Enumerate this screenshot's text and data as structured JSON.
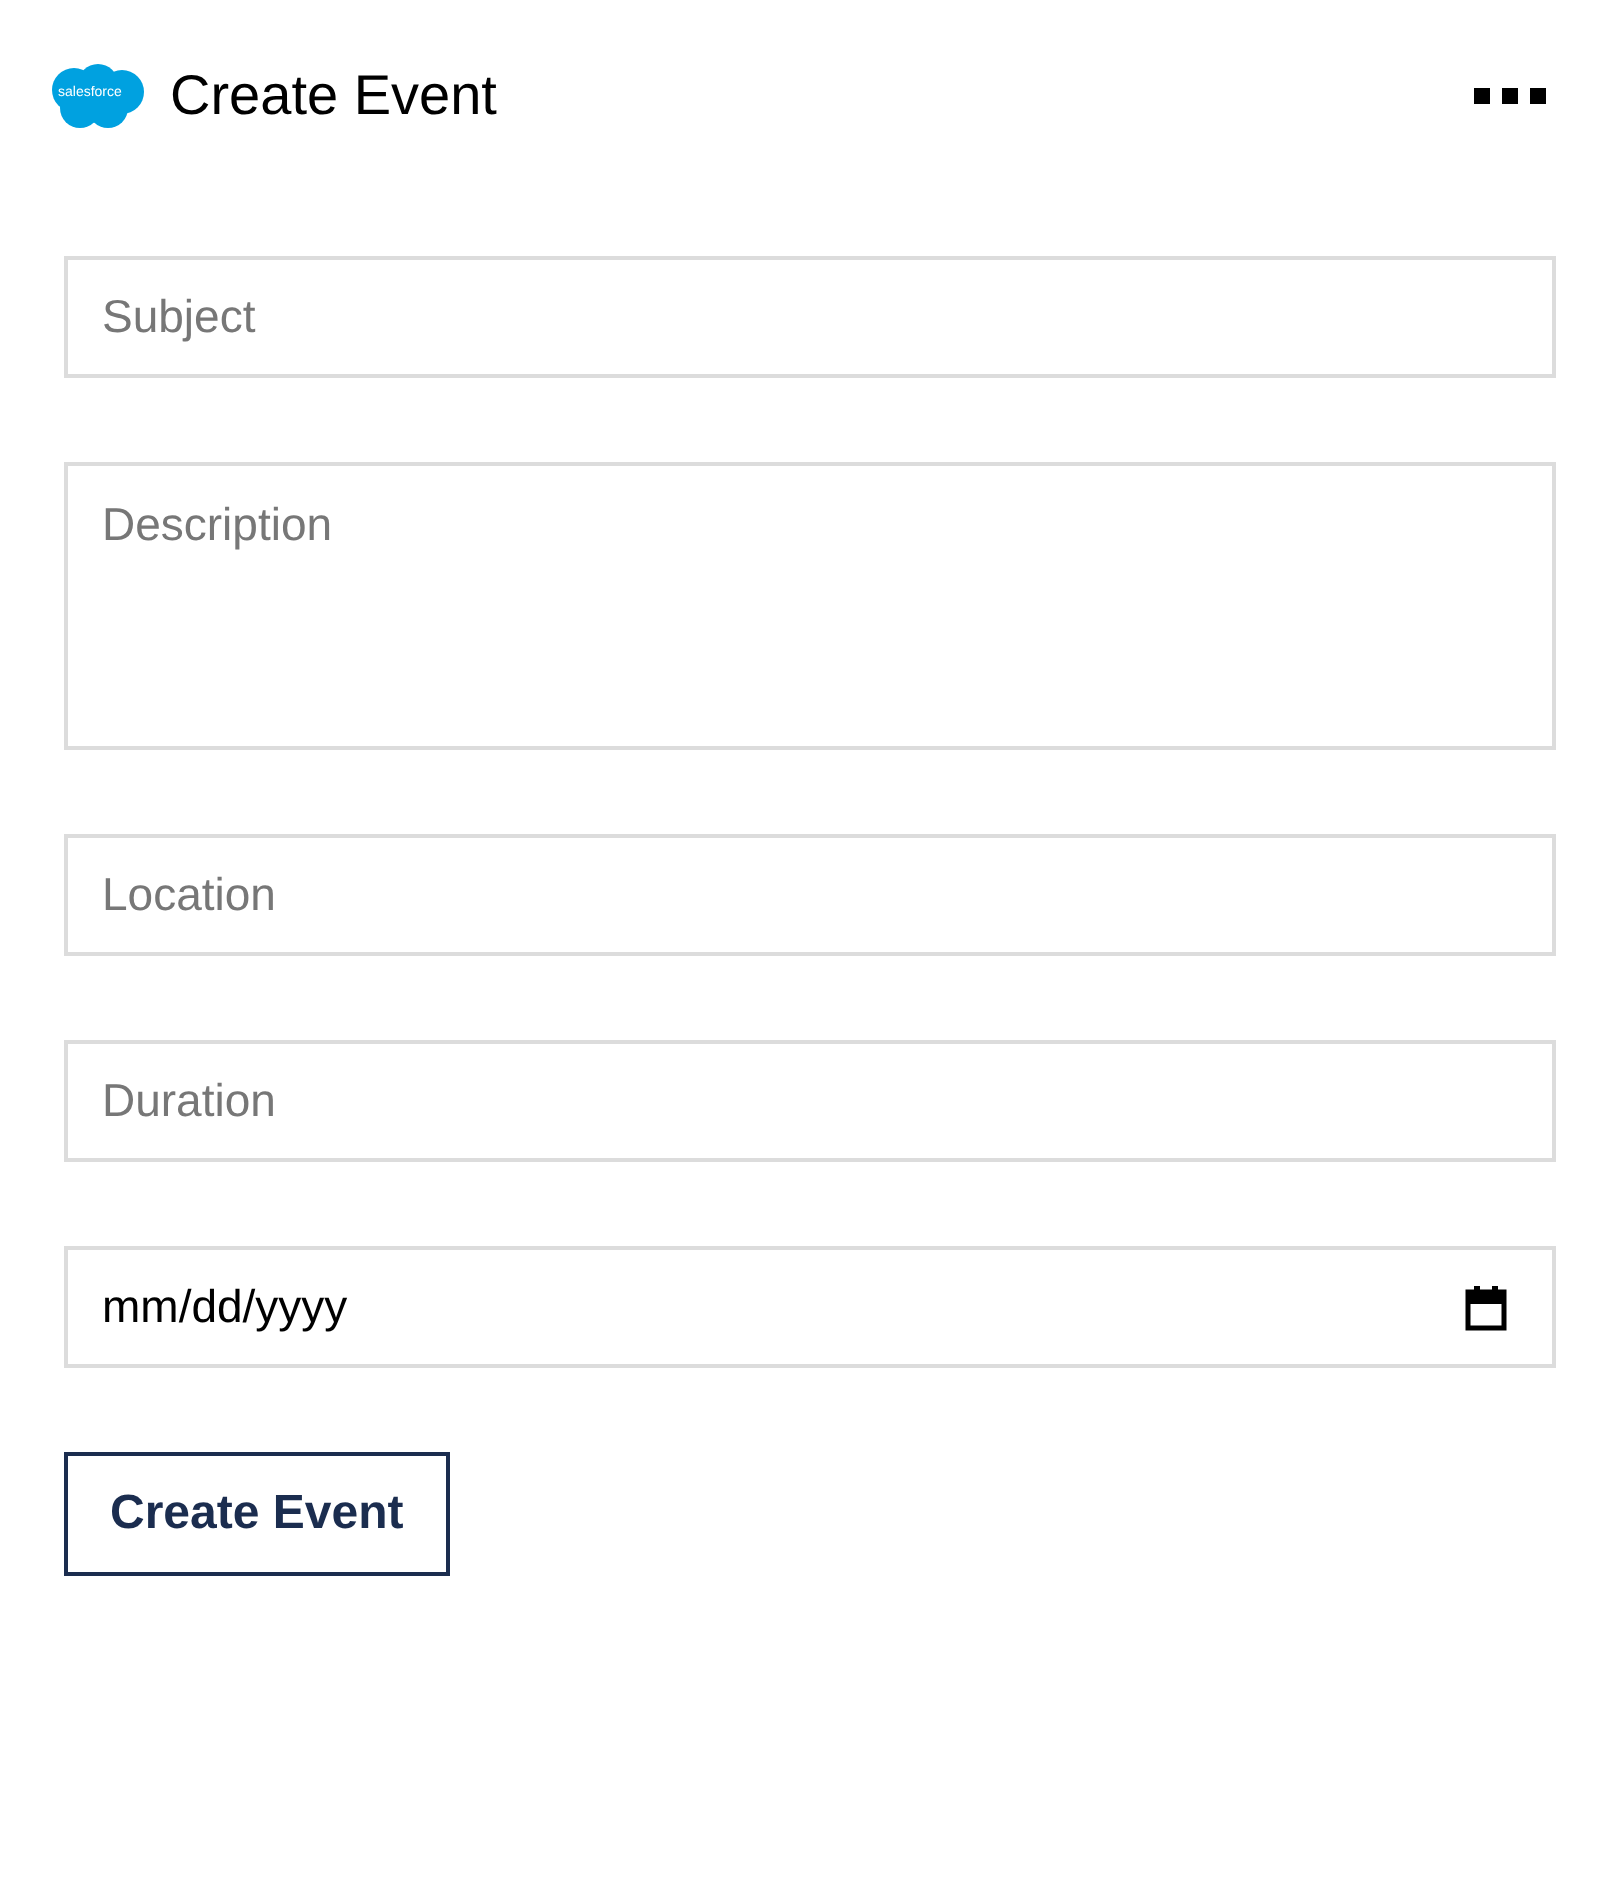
{
  "header": {
    "logo_text": "salesforce",
    "title": "Create Event"
  },
  "fields": [
    {
      "kind": "text",
      "placeholder": "Subject"
    },
    {
      "kind": "textarea",
      "placeholder": "Description"
    },
    {
      "kind": "text",
      "placeholder": "Location"
    },
    {
      "kind": "text",
      "placeholder": "Duration"
    },
    {
      "kind": "date",
      "value": "mm/dd/yyyy"
    }
  ],
  "submit_button": "Create Event"
}
